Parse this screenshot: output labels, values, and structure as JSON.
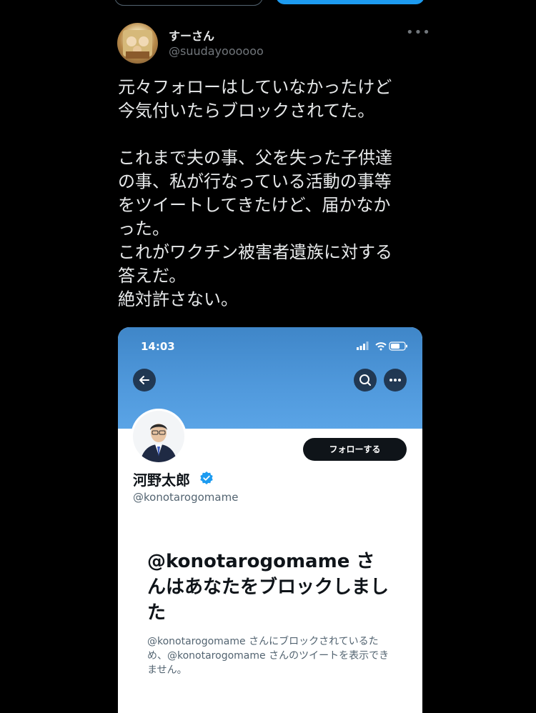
{
  "tweet": {
    "display_name": "すーさん",
    "handle": "@suudayoooooo",
    "more_icon": "more-horizontal-icon",
    "text": "元々フォローはしていなかったけど\n今気付いたらブロックされてた。\n\nこれまで夫の事、父を失った子供達\nの事、私が行なっている活動の事等\nをツイートしてきたけど、届かなか\nった。\nこれがワクチン被害者遺族に対する\n答えだ。\n絶対許さない。"
  },
  "screenshot": {
    "status_time": "14:03",
    "header_buttons": [
      "back-arrow-icon",
      "search-icon",
      "more-horizontal-icon"
    ],
    "follow_label": "フォローする",
    "profile_name": "河野太郎",
    "profile_handle": "@konotarogomame",
    "blocked_title": "@konotarogomame さんはあなたをブロックしました",
    "blocked_desc": "@konotarogomame さんにブロックされているため、@konotarogomame さんのツイートを表示できません。",
    "colors": {
      "banner": "#4f98db",
      "follow_button": "#0f1419",
      "verified": "#1d9bf0"
    }
  }
}
